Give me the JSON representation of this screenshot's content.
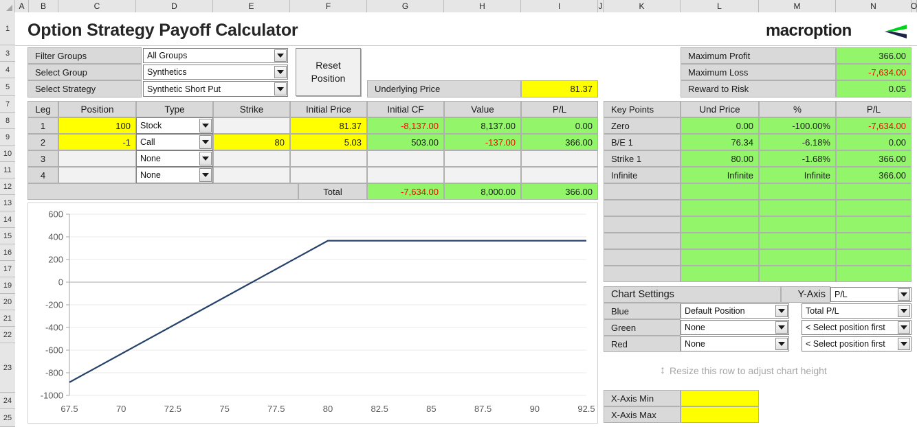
{
  "workbook": {
    "column_headers": [
      "A",
      "B",
      "C",
      "D",
      "E",
      "F",
      "G",
      "H",
      "I",
      "J",
      "K",
      "L",
      "M",
      "N",
      "O"
    ],
    "row_headers": [
      "1",
      "3",
      "4",
      "5",
      "7",
      "8",
      "9",
      "10",
      "11",
      "12",
      "13",
      "14",
      "15",
      "16",
      "17",
      "19",
      "20",
      "21",
      "22",
      "23",
      "24",
      "25"
    ]
  },
  "header": {
    "title": "Option Strategy Payoff Calculator",
    "logo_text": "macroption"
  },
  "strategy_selector": {
    "rows": [
      {
        "label": "Filter Groups",
        "value": "All Groups"
      },
      {
        "label": "Select Group",
        "value": "Synthetics"
      },
      {
        "label": "Select Strategy",
        "value": "Synthetic Short Put"
      }
    ],
    "reset_button": {
      "line1": "Reset",
      "line2": "Position"
    }
  },
  "underlying": {
    "label": "Underlying Price",
    "value": "81.37"
  },
  "summary": {
    "rows": [
      {
        "label": "Maximum Profit",
        "value": "366.00",
        "negative": false
      },
      {
        "label": "Maximum Loss",
        "value": "-7,634.00",
        "negative": true
      },
      {
        "label": "Reward to Risk",
        "value": "0.05",
        "negative": false
      }
    ]
  },
  "legs_table": {
    "headers": [
      "Leg",
      "Position",
      "Type",
      "Strike",
      "Initial Price",
      "Initial CF",
      "Value",
      "P/L"
    ],
    "rows": [
      {
        "leg": "1",
        "position": "100",
        "type": "Stock",
        "strike": "",
        "initial_price": "81.37",
        "initial_cf": "-8,137.00",
        "cf_negative": true,
        "value": "8,137.00",
        "value_negative": false,
        "pl": "0.00",
        "pl_negative": false,
        "filled": true
      },
      {
        "leg": "2",
        "position": "-1",
        "type": "Call",
        "strike": "80",
        "initial_price": "5.03",
        "initial_cf": "503.00",
        "cf_negative": false,
        "value": "-137.00",
        "value_negative": true,
        "pl": "366.00",
        "pl_negative": false,
        "filled": true
      },
      {
        "leg": "3",
        "position": "",
        "type": "None",
        "strike": "",
        "initial_price": "",
        "initial_cf": "",
        "cf_negative": false,
        "value": "",
        "value_negative": false,
        "pl": "",
        "pl_negative": false,
        "filled": false
      },
      {
        "leg": "4",
        "position": "",
        "type": "None",
        "strike": "",
        "initial_price": "",
        "initial_cf": "",
        "cf_negative": false,
        "value": "",
        "value_negative": false,
        "pl": "",
        "pl_negative": false,
        "filled": false
      }
    ],
    "total": {
      "label": "Total",
      "initial_cf": "-7,634.00",
      "cf_negative": true,
      "value": "8,000.00",
      "pl": "366.00"
    }
  },
  "key_points": {
    "headers": [
      "Key Points",
      "Und Price",
      "%",
      "P/L"
    ],
    "rows": [
      {
        "name": "Zero",
        "und_price": "0.00",
        "pct": "-100.00%",
        "pl": "-7,634.00",
        "pl_negative": true
      },
      {
        "name": "B/E 1",
        "und_price": "76.34",
        "pct": "-6.18%",
        "pl": "0.00",
        "pl_negative": false
      },
      {
        "name": "Strike 1",
        "und_price": "80.00",
        "pct": "-1.68%",
        "pl": "366.00",
        "pl_negative": false
      },
      {
        "name": "Infinite",
        "und_price": "Infinite",
        "pct": "Infinite",
        "pl": "366.00",
        "pl_negative": false
      }
    ],
    "blank_row_count": 6
  },
  "chart_settings": {
    "title": "Chart Settings",
    "y_axis_label": "Y-Axis",
    "y_axis_value": "P/L",
    "rows": [
      {
        "color_label": "Blue",
        "position": "Default Position",
        "series": "Total P/L"
      },
      {
        "color_label": "Green",
        "position": "None",
        "series": "< Select position first"
      },
      {
        "color_label": "Red",
        "position": "None",
        "series": "< Select position first"
      }
    ],
    "resize_hint": "Resize this row to adjust chart height",
    "x_axis_min": {
      "label": "X-Axis Min",
      "value": ""
    },
    "x_axis_max": {
      "label": "X-Axis Max",
      "value": ""
    }
  },
  "colors": {
    "line": "#26426b",
    "highlight_yellow": "#ffff00",
    "highlight_green": "#92f56a",
    "negative_red": "#ff0000",
    "logo_green": "#00d21e",
    "logo_navy": "#1a2347"
  },
  "chart_data": {
    "type": "line",
    "title": "",
    "xlabel": "",
    "ylabel": "",
    "xlim": [
      67.5,
      92.5
    ],
    "ylim": [
      -1000,
      600
    ],
    "xticks": [
      67.5,
      70,
      72.5,
      75,
      77.5,
      80,
      82.5,
      85,
      87.5,
      90,
      92.5
    ],
    "xtick_labels": [
      "67.5",
      "70",
      "72.5",
      "75",
      "77.5",
      "80",
      "82.5",
      "85",
      "87.5",
      "90",
      "92.5"
    ],
    "yticks": [
      -1000,
      -800,
      -600,
      -400,
      -200,
      0,
      200,
      400,
      600
    ],
    "ytick_labels": [
      "-1000",
      "-800",
      "-600",
      "-400",
      "-200",
      "0",
      "200",
      "400",
      "600"
    ],
    "grid": true,
    "legend": false,
    "series": [
      {
        "name": "Total P/L",
        "color": "#26426b",
        "x": [
          67.5,
          70,
          72.5,
          75,
          76.34,
          77.5,
          80,
          82.5,
          85,
          87.5,
          90,
          92.5
        ],
        "y": [
          -884,
          -634,
          -384,
          -134,
          0,
          116,
          366,
          366,
          366,
          366,
          366,
          366
        ]
      }
    ]
  }
}
